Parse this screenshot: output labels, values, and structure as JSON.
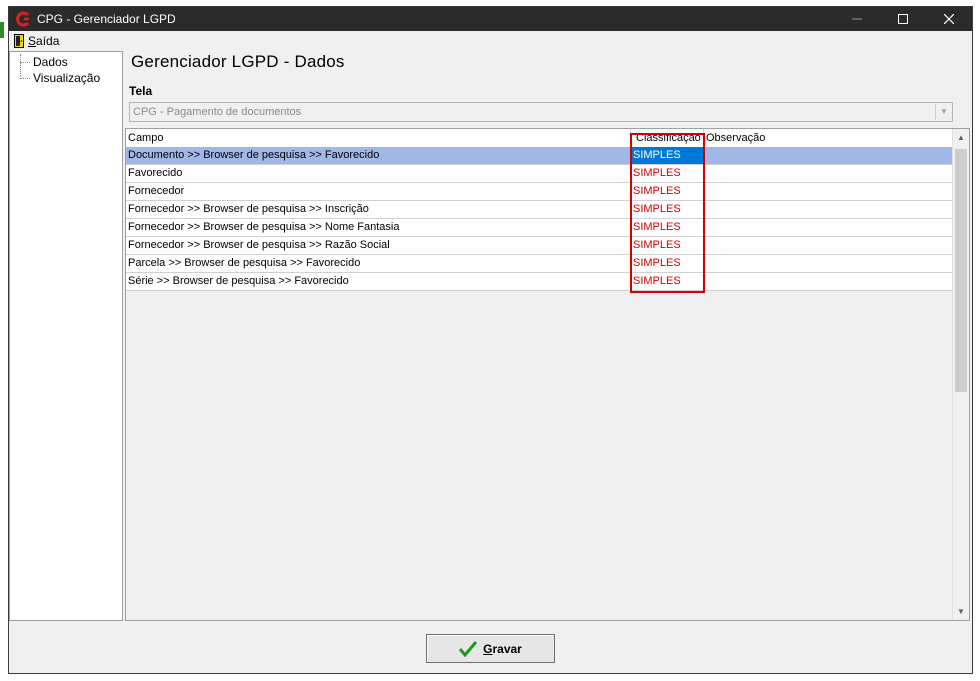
{
  "window": {
    "title": "CPG - Gerenciador LGPD"
  },
  "menu": {
    "exit_label": "Saída"
  },
  "tree": {
    "items": [
      {
        "label": "Dados"
      },
      {
        "label": "Visualização"
      }
    ]
  },
  "main": {
    "title": "Gerenciador LGPD - Dados",
    "tela_label": "Tela",
    "tela_value": "CPG - Pagamento de documentos"
  },
  "grid": {
    "columns": [
      "Campo",
      "Classificação",
      "Observação"
    ],
    "rows": [
      {
        "campo": "Documento >> Browser de pesquisa >> Favorecido",
        "classificacao": "SIMPLES",
        "observacao": ""
      },
      {
        "campo": "Favorecido",
        "classificacao": "SIMPLES",
        "observacao": ""
      },
      {
        "campo": "Fornecedor",
        "classificacao": "SIMPLES",
        "observacao": ""
      },
      {
        "campo": "Fornecedor >> Browser de pesquisa >> Inscrição",
        "classificacao": "SIMPLES",
        "observacao": ""
      },
      {
        "campo": "Fornecedor >> Browser de pesquisa >> Nome Fantasia",
        "classificacao": "SIMPLES",
        "observacao": ""
      },
      {
        "campo": "Fornecedor >> Browser de pesquisa >> Razão Social",
        "classificacao": "SIMPLES",
        "observacao": ""
      },
      {
        "campo": "Parcela >> Browser de pesquisa >> Favorecido",
        "classificacao": "SIMPLES",
        "observacao": ""
      },
      {
        "campo": "Série >> Browser de pesquisa >> Favorecido",
        "classificacao": "SIMPLES",
        "observacao": ""
      }
    ],
    "selected_row": 0
  },
  "footer": {
    "save_label": "Gravar"
  },
  "colors": {
    "titlebar": "#2b2b2b",
    "selection": "#0078d7",
    "row_selection": "#a0b8e8",
    "classification_text": "#d40000",
    "check_green": "#1a9a1a"
  }
}
